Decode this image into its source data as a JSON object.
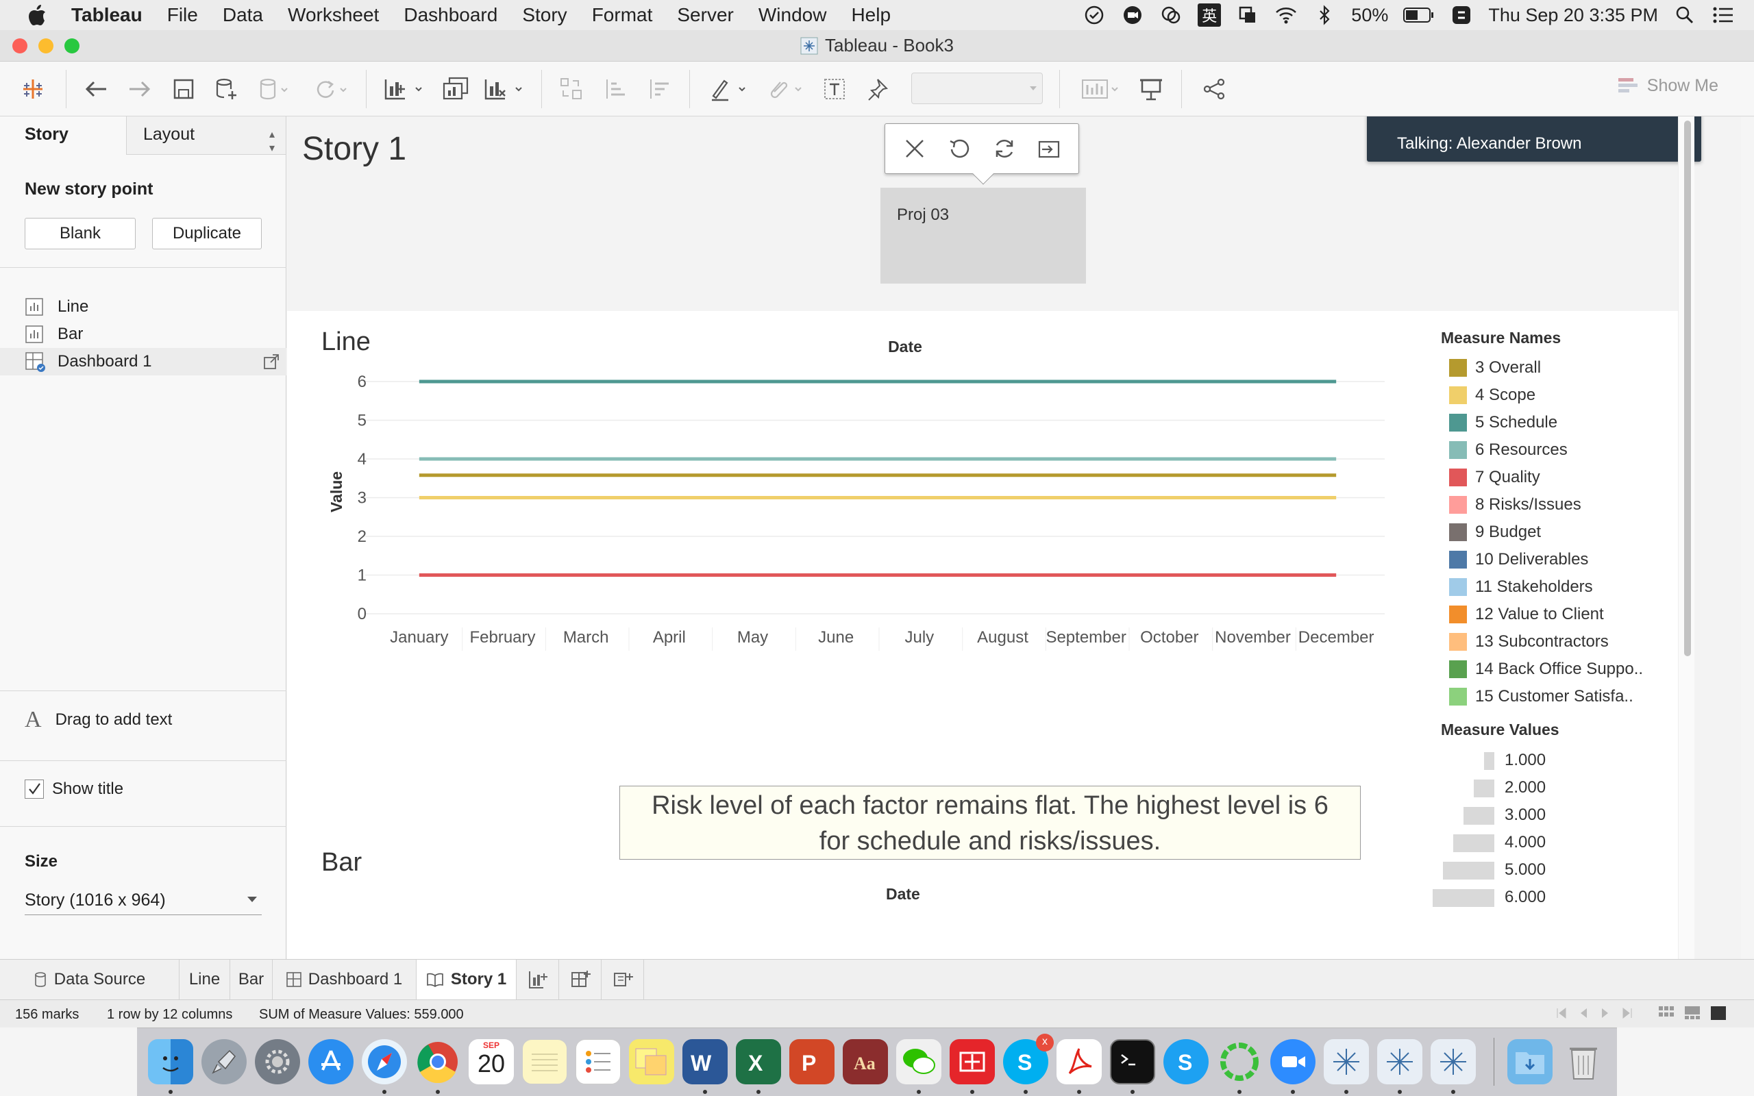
{
  "menubar": {
    "app_name": "Tableau",
    "items": [
      "File",
      "Data",
      "Worksheet",
      "Dashboard",
      "Story",
      "Format",
      "Server",
      "Window",
      "Help"
    ],
    "battery": "50%",
    "clock": "Thu Sep 20  3:35 PM",
    "input_method": "英"
  },
  "window": {
    "title": "Tableau - Book3"
  },
  "toolbar": {
    "show_me": "Show Me"
  },
  "sidebar": {
    "tab_story": "Story",
    "tab_layout": "Layout",
    "new_story_point": "New story point",
    "blank_button": "Blank",
    "duplicate_button": "Duplicate",
    "sheets": [
      "Line",
      "Bar",
      "Dashboard 1"
    ],
    "drag_text": "Drag to add text",
    "show_title": "Show title",
    "size_label": "Size",
    "size_value": "Story (1016 x 964)"
  },
  "story": {
    "title": "Story 1",
    "story_point_caption": "Proj 03",
    "talking_banner": "Talking: Alexander Brown"
  },
  "dashboard": {
    "line_title": "Line",
    "bar_title": "Bar",
    "annotation_line1": "Risk level of each factor remains flat. The highest level is 6",
    "annotation_line2": "for schedule and risks/issues.",
    "legend_names_title": "Measure Names",
    "legend_names": [
      {
        "label": "3 Overall",
        "color": "#b59a2e"
      },
      {
        "label": "4 Scope",
        "color": "#f0cf6a"
      },
      {
        "label": "5 Schedule",
        "color": "#4e9891"
      },
      {
        "label": "6 Resources",
        "color": "#86bcb6"
      },
      {
        "label": "7 Quality",
        "color": "#e15759"
      },
      {
        "label": "8 Risks/Issues",
        "color": "#ff9d9a"
      },
      {
        "label": "9 Budget",
        "color": "#79706e"
      },
      {
        "label": "10 Deliverables",
        "color": "#4e79a7"
      },
      {
        "label": "11 Stakeholders",
        "color": "#a0cbe8"
      },
      {
        "label": "12 Value to Client",
        "color": "#f28e2b"
      },
      {
        "label": "13 Subcontractors",
        "color": "#ffbe7d"
      },
      {
        "label": "14 Back Office Suppo..",
        "color": "#59a14f"
      },
      {
        "label": "15 Customer Satisfa..",
        "color": "#8cd17d"
      }
    ],
    "legend_values_title": "Measure Values",
    "legend_values": [
      "1.000",
      "2.000",
      "3.000",
      "4.000",
      "5.000",
      "6.000"
    ]
  },
  "chart_data": [
    {
      "type": "line",
      "title": "Line",
      "xlabel": "Date",
      "ylabel": "Value",
      "ylim": [
        0,
        6.3
      ],
      "yticks": [
        0,
        1,
        2,
        3,
        4,
        5,
        6
      ],
      "grid": true,
      "legend": "right",
      "categories": [
        "January",
        "February",
        "March",
        "April",
        "May",
        "June",
        "July",
        "August",
        "September",
        "October",
        "November",
        "December"
      ],
      "series": [
        {
          "color": "#4e9891",
          "values": [
            6,
            6,
            6,
            6,
            6,
            6,
            6,
            6,
            6,
            6,
            6,
            6
          ]
        },
        {
          "color": "#86bcb6",
          "values": [
            4,
            4,
            4,
            4,
            4,
            4,
            4,
            4,
            4,
            4,
            4,
            4
          ]
        },
        {
          "color": "#b59a2e",
          "values": [
            3.58,
            3.58,
            3.58,
            3.58,
            3.58,
            3.58,
            3.58,
            3.58,
            3.58,
            3.58,
            3.58,
            3.58
          ]
        },
        {
          "color": "#f0cf6a",
          "values": [
            3,
            3,
            3,
            3,
            3,
            3,
            3,
            3,
            3,
            3,
            3,
            3
          ]
        },
        {
          "color": "#e15759",
          "values": [
            1,
            1,
            1,
            1,
            1,
            1,
            1,
            1,
            1,
            1,
            1,
            1
          ]
        }
      ]
    },
    {
      "type": "bar",
      "title": "Bar",
      "xlabel": "Date"
    }
  ],
  "tabs": {
    "data_source": "Data Source",
    "items": [
      "Line",
      "Bar",
      "Dashboard 1",
      "Story 1"
    ]
  },
  "statusbar": {
    "marks": "156 marks",
    "rows_cols": "1 row by 12 columns",
    "sum": "SUM of Measure Values: 559.000"
  },
  "dock": {
    "calendar_month": "SEP",
    "calendar_day": "20",
    "skype_badge": "x"
  }
}
